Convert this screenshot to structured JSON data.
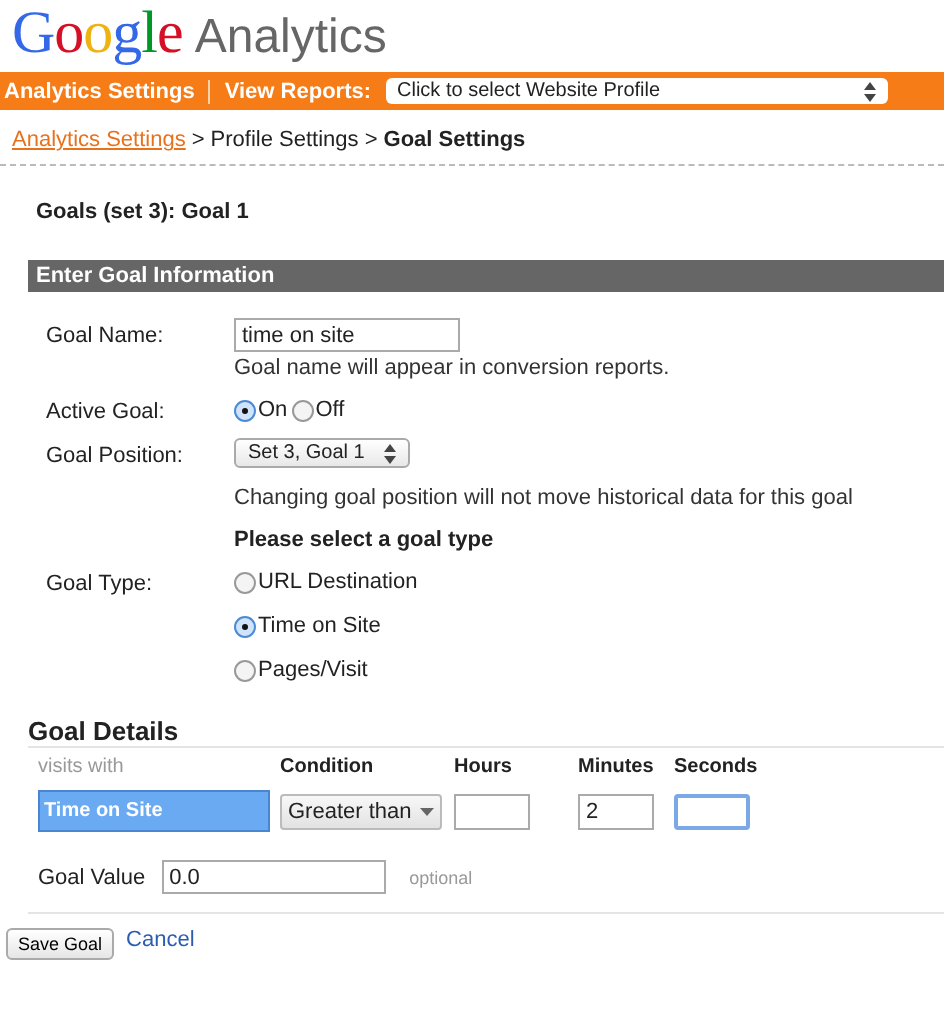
{
  "logo": {
    "brand": "Google",
    "product": "Analytics"
  },
  "nav": {
    "settings": "Analytics Settings",
    "view_reports": "View Reports:",
    "profile_select": "Click to select Website Profile"
  },
  "breadcrumb": {
    "link": "Analytics Settings",
    "middle": "> Profile Settings >",
    "current": "Goal Settings"
  },
  "page_title": "Goals (set 3): Goal 1",
  "section_header": "Enter Goal Information",
  "goal_name": {
    "label": "Goal Name:",
    "value": "time on site",
    "hint": "Goal name will appear in conversion reports."
  },
  "active_goal": {
    "label": "Active Goal:",
    "options": [
      {
        "label": "On",
        "selected": true
      },
      {
        "label": "Off",
        "selected": false
      }
    ]
  },
  "goal_position": {
    "label": "Goal Position:",
    "value": "Set 3, Goal 1",
    "hint": "Changing goal position will not move historical data for this goal"
  },
  "goal_type": {
    "heading": "Please select a goal type",
    "label": "Goal Type:",
    "options": [
      {
        "label": "URL Destination",
        "selected": false
      },
      {
        "label": "Time on Site",
        "selected": true
      },
      {
        "label": "Pages/Visit",
        "selected": false
      }
    ]
  },
  "goal_details": {
    "title": "Goal Details",
    "columns": [
      "visits with",
      "Condition",
      "Hours",
      "Minutes",
      "Seconds"
    ],
    "type": "Time on Site",
    "condition": "Greater than",
    "minutes": "2"
  },
  "goal_value": {
    "label": "Goal Value",
    "value": "0.0",
    "note": "optional"
  },
  "buttons": {
    "save": "Save Goal",
    "cancel": "Cancel"
  }
}
